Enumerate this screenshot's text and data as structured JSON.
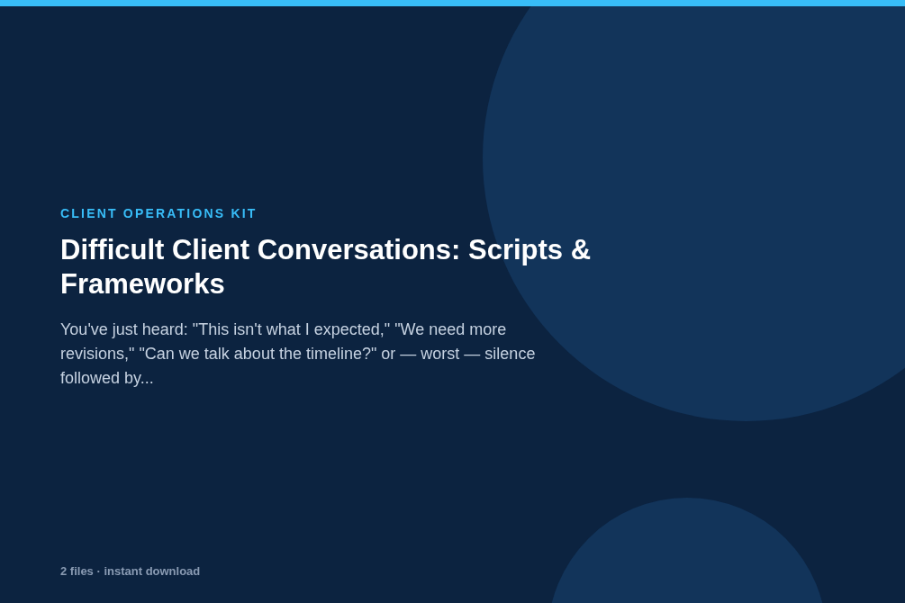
{
  "eyebrow": "CLIENT OPERATIONS KIT",
  "title": "Difficult Client Conversations: Scripts & Frameworks",
  "description": "You've just heard: \"This isn't what I expected,\" \"We need more revisions,\" \"Can we talk about the timeline?\" or — worst — silence followed by...",
  "footer": "2 files · instant download"
}
